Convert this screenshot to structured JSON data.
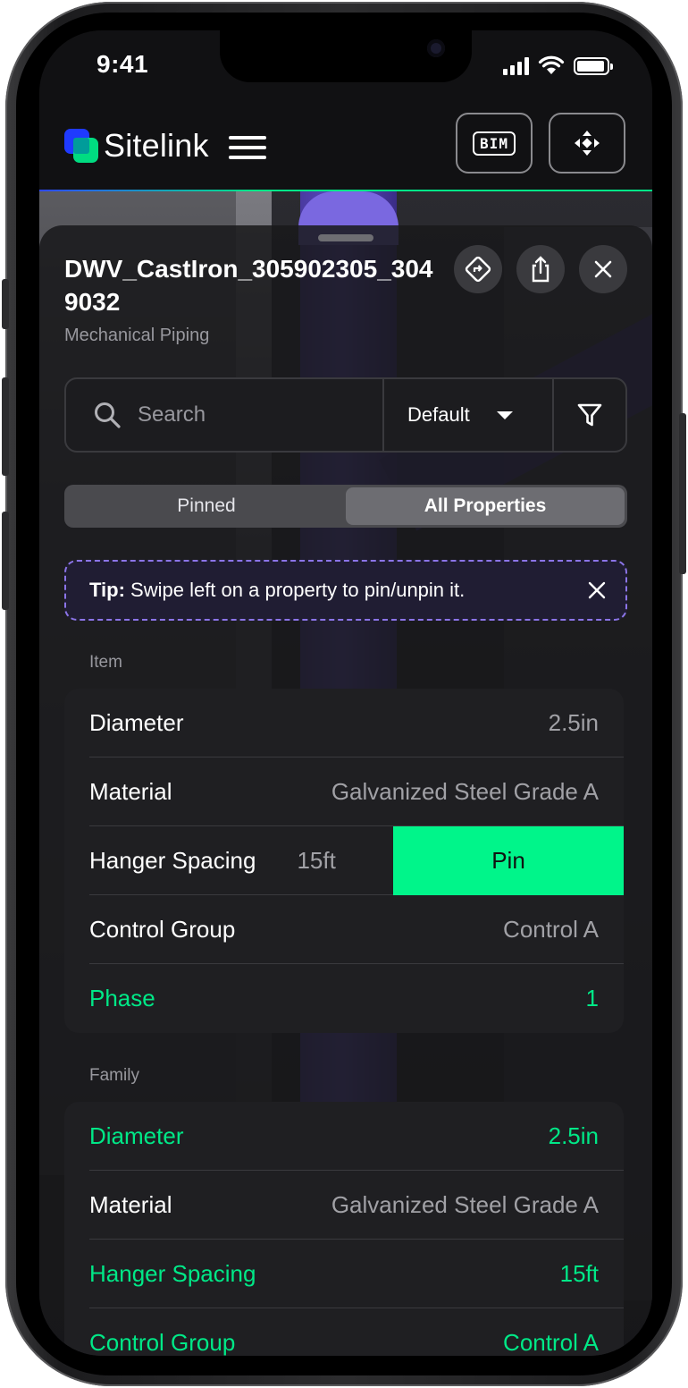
{
  "status_bar": {
    "time": "9:41"
  },
  "header": {
    "brand": "Sitelink",
    "bim_label": "BIM"
  },
  "panel": {
    "title": "DWV_CastIron_305902305_3049032",
    "subtitle": "Mechanical Piping"
  },
  "search": {
    "placeholder": "Search",
    "sort_value": "Default"
  },
  "tabs": {
    "pinned": "Pinned",
    "all": "All Properties",
    "active": "All Properties"
  },
  "tip": {
    "bold": "Tip:",
    "text": " Swipe left on a property to pin/unpin it."
  },
  "sections": [
    {
      "label": "Item",
      "rows": [
        {
          "key": "Diameter",
          "value": "2.5in",
          "pinned": false
        },
        {
          "key": "Material",
          "value": "Galvanized Steel Grade A",
          "pinned": false
        },
        {
          "key": "Hanger Spacing",
          "value": "15ft",
          "pinned": false,
          "swipe_action": "Pin"
        },
        {
          "key": "Control Group",
          "value": "Control A",
          "pinned": false
        },
        {
          "key": "Phase",
          "value": "1",
          "pinned": true
        }
      ]
    },
    {
      "label": "Family",
      "rows": [
        {
          "key": "Diameter",
          "value": "2.5in",
          "pinned": true
        },
        {
          "key": "Material",
          "value": "Galvanized Steel Grade A",
          "pinned": false
        },
        {
          "key": "Hanger Spacing",
          "value": "15ft",
          "pinned": true
        },
        {
          "key": "Control Group",
          "value": "Control A",
          "pinned": true
        }
      ]
    }
  ],
  "colors": {
    "accent": "#00e887",
    "brand_blue": "#1f3aff",
    "tip_border": "#8b74e8"
  }
}
